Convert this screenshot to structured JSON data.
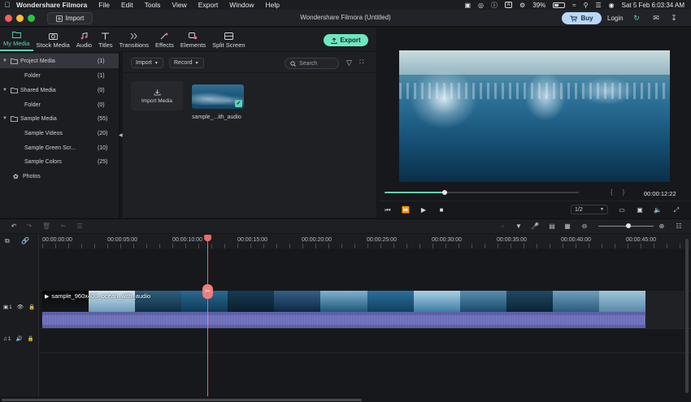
{
  "menubar": {
    "app_name": "Wondershare Filmora",
    "items": [
      "File",
      "Edit",
      "Tools",
      "View",
      "Export",
      "Window",
      "Help"
    ],
    "battery": "39%",
    "input_source": "A",
    "datetime": "Sat 5 Feb  6:03:34 AM"
  },
  "titlebar": {
    "import_label": "Import",
    "title": "Wondershare Filmora (Untitled)",
    "buy_label": "Buy",
    "login_label": "Login"
  },
  "tabs": [
    {
      "label": "My Media",
      "icon": "folder-icon"
    },
    {
      "label": "Stock Media",
      "icon": "camera-icon"
    },
    {
      "label": "Audio",
      "icon": "music-icon"
    },
    {
      "label": "Titles",
      "icon": "text-icon"
    },
    {
      "label": "Transitions",
      "icon": "transition-icon"
    },
    {
      "label": "Effects",
      "icon": "effects-icon"
    },
    {
      "label": "Elements",
      "icon": "elements-icon"
    },
    {
      "label": "Split Screen",
      "icon": "split-screen-icon"
    }
  ],
  "export_label": "Export",
  "tree": [
    {
      "label": "Project Media",
      "count": "(1)"
    },
    {
      "label": "Folder",
      "count": "(1)"
    },
    {
      "label": "Shared Media",
      "count": "(0)"
    },
    {
      "label": "Folder",
      "count": "(0)"
    },
    {
      "label": "Sample Media",
      "count": "(55)"
    },
    {
      "label": "Sample Videos",
      "count": "(20)"
    },
    {
      "label": "Sample Green Scr...",
      "count": "(10)"
    },
    {
      "label": "Sample Colors",
      "count": "(25)"
    },
    {
      "label": "Photos",
      "count": ""
    }
  ],
  "media_toolbar": {
    "import_label": "Import",
    "record_label": "Record",
    "search_placeholder": "Search"
  },
  "media_items": {
    "import_tile_label": "Import Media",
    "clip_label": "sample_...ith_audio"
  },
  "preview": {
    "progress": 0.31,
    "timecode": "00:00:12:22",
    "ratio": "1/2"
  },
  "ruler_labels": [
    "00:00:00:00",
    "00:00:05:00",
    "00:00:10:00",
    "00:00:15:00",
    "00:00:20:00",
    "00:00:25:00",
    "00:00:30:00",
    "00:00:35:00",
    "00:00:40:00",
    "00:00:45:00"
  ],
  "timeline": {
    "clip_name": "sample_960x400_ocean_with_audio",
    "video_track_label": "1",
    "audio_track_label": "1",
    "zoom_level": 0.55
  },
  "colors": {
    "accent": "#5fd3b4",
    "playhead": "#ef6a6a",
    "audio_clip": "#5d60a8",
    "buy_button": "#b9d8f6"
  }
}
